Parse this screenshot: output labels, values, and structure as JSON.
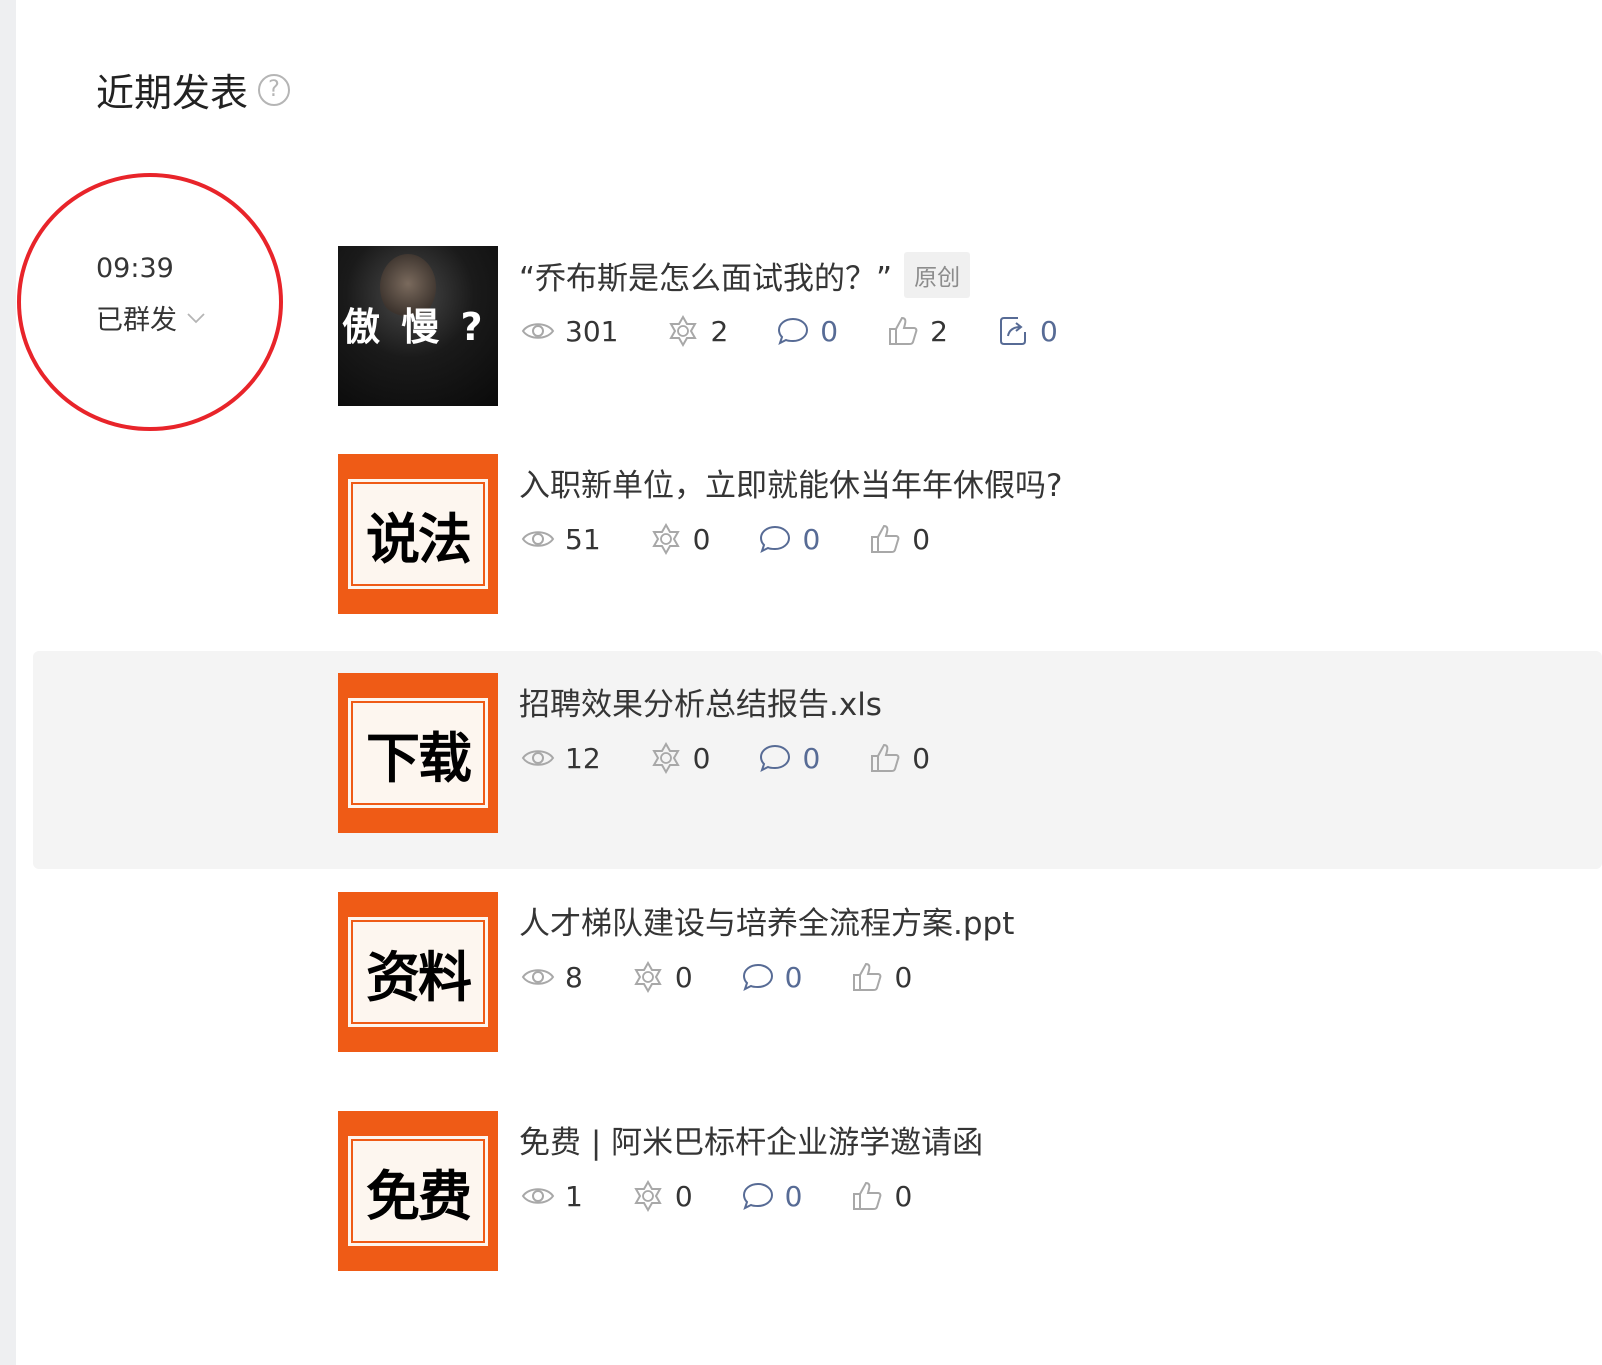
{
  "section": {
    "title": "近期发表",
    "help_icon": "question-circle-icon"
  },
  "group": {
    "time": "09:39",
    "status": "已群发",
    "annotation_color": "#e8242a"
  },
  "articles": [
    {
      "title": "“乔布斯是怎么面试我的？”",
      "badge": "原创",
      "thumb_text": "傲 慢 ? !",
      "stats": {
        "views": "301",
        "stars": "2",
        "comments": "0",
        "likes": "2",
        "shares": "0"
      }
    },
    {
      "title": "入职新单位，立即就能休当年年休假吗?",
      "thumb_text": "说法",
      "stats": {
        "views": "51",
        "stars": "0",
        "comments": "0",
        "likes": "0"
      }
    },
    {
      "title": "招聘效果分析总结报告.xls",
      "thumb_text": "下载",
      "stats": {
        "views": "12",
        "stars": "0",
        "comments": "0",
        "likes": "0"
      }
    },
    {
      "title": "人才梯队建设与培养全流程方案.ppt",
      "thumb_text": "资料",
      "stats": {
        "views": "8",
        "stars": "0",
        "comments": "0",
        "likes": "0"
      }
    },
    {
      "title": "免费 | 阿米巴标杆企业游学邀请函",
      "thumb_text": "免费",
      "stats": {
        "views": "1",
        "stars": "0",
        "comments": "0",
        "likes": "0"
      }
    }
  ],
  "colors": {
    "accent_blue": "#576b95",
    "thumb_orange": "#ef5b16",
    "hover_bg": "#f4f4f4"
  }
}
